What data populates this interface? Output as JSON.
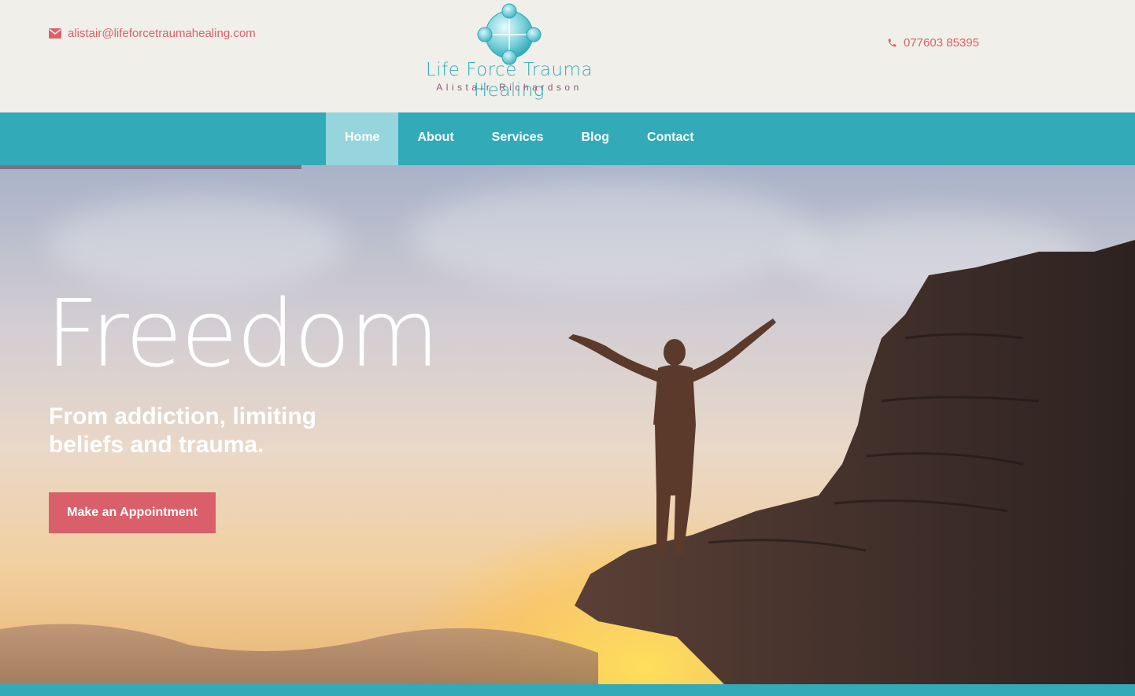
{
  "header": {
    "email": "alistair@lifeforcetraumahealing.com",
    "phone": "077603 85395",
    "logo": {
      "title": "Life Force Trauma Healing",
      "subtitle": "Alistair Richardson"
    }
  },
  "nav": {
    "items": [
      {
        "label": "Home",
        "active": true
      },
      {
        "label": "About",
        "active": false
      },
      {
        "label": "Services",
        "active": false
      },
      {
        "label": "Blog",
        "active": false
      },
      {
        "label": "Contact",
        "active": false
      }
    ]
  },
  "hero": {
    "title": "Freedom",
    "subtitle": "From addiction, limiting beliefs and trauma.",
    "button_label": "Make an Appointment"
  },
  "icons": {
    "email": "envelope-icon",
    "phone": "phone-icon"
  },
  "colors": {
    "accent_teal": "#33aab7",
    "nav_active": "#96d5dd",
    "cta_red": "#d9606a",
    "contact_text": "#d9626a",
    "header_bg": "#f0efe9"
  }
}
